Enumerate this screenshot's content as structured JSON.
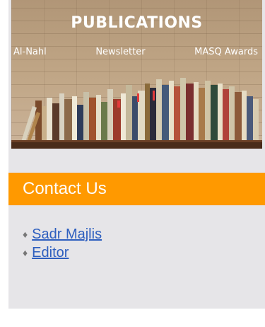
{
  "publications_banner": {
    "title": "PUBLICATIONS",
    "links": [
      "Al-Nahl",
      "Newsletter",
      "MASQ Awards"
    ]
  },
  "contact": {
    "heading": "Contact Us",
    "items": [
      {
        "label": "Sadr Majlis"
      },
      {
        "label": "Editor"
      }
    ]
  },
  "colors": {
    "accent": "#ff9900",
    "link": "#2e5fbf",
    "panel_bg": "#e6e5e8"
  }
}
